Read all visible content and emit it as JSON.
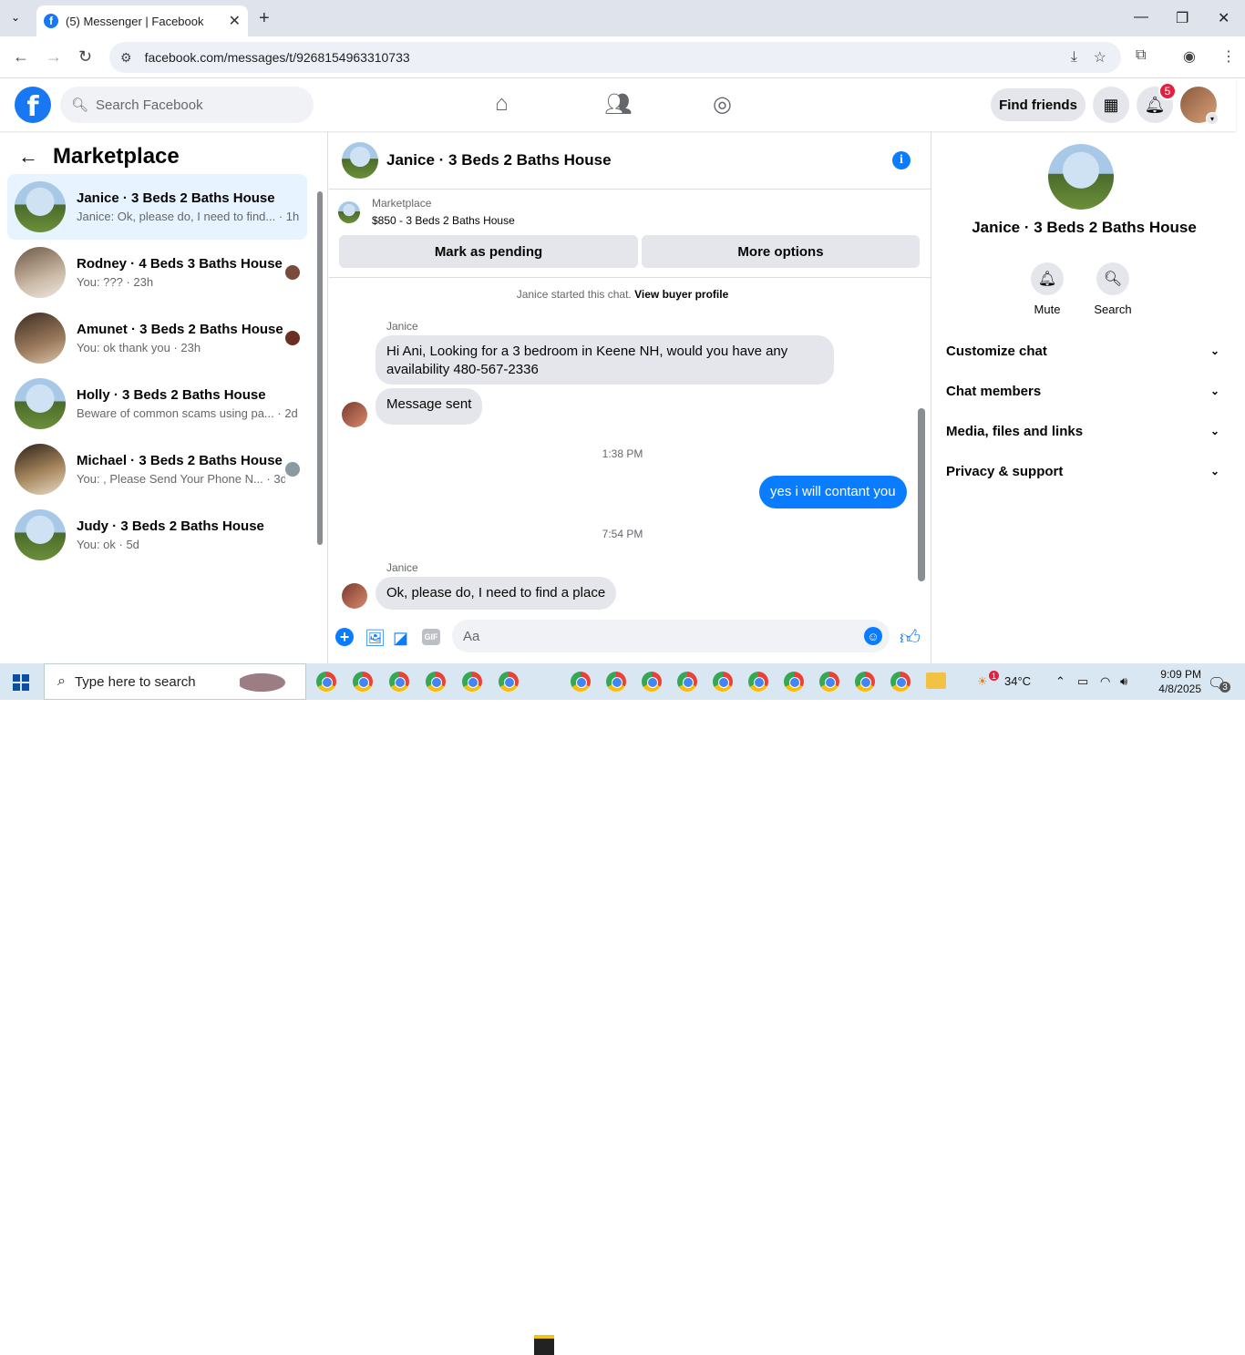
{
  "browser": {
    "tab_title": "(5) Messenger | Facebook",
    "url": "facebook.com/messages/t/9268154963310733"
  },
  "fb_header": {
    "search_placeholder": "Search Facebook",
    "find_friends": "Find friends",
    "notification_count": "5"
  },
  "left": {
    "title": "Marketplace",
    "conversations": [
      {
        "name": "Janice · 3 Beds 2 Baths House",
        "preview": "Janice: Ok, please do, I need to find... · 1h"
      },
      {
        "name": "Rodney · 4 Beds 3 Baths House",
        "preview": "You: ??? · 23h"
      },
      {
        "name": "Amunet · 3 Beds 2 Baths House",
        "preview": "You: ok thank you · 23h"
      },
      {
        "name": "Holly · 3 Beds 2 Baths House",
        "preview": "Beware of common scams using pa... · 2d"
      },
      {
        "name": "Michael · 3 Beds 2 Baths House",
        "preview": "You: , Please Send Your Phone N... · 3d"
      },
      {
        "name": "Judy · 3 Beds 2 Baths House",
        "preview": "You: ok · 5d"
      }
    ]
  },
  "chat": {
    "title": "Janice · 3 Beds 2 Baths House",
    "listing_label": "Marketplace",
    "listing_price": "$850 - 3 Beds 2 Baths House",
    "btn_pending": "Mark as pending",
    "btn_more": "More options",
    "system_msg": "Janice started this chat.",
    "view_profile": "View buyer profile",
    "sender1": "Janice",
    "msg1": "Hi Ani,  Looking for a 3 bedroom in Keene NH, would you have any availability 480-567-2336",
    "msg2": "Message sent",
    "time1": "1:38 PM",
    "msg3": "yes i will contant you",
    "time2": "7:54 PM",
    "sender2": "Janice",
    "msg4": "Ok, please do, I need to find a place",
    "composer_placeholder": "Aa"
  },
  "right": {
    "name": "Janice · 3 Beds 2 Baths House",
    "mute": "Mute",
    "search": "Search",
    "sections": [
      "Customize chat",
      "Chat members",
      "Media, files and links",
      "Privacy & support"
    ]
  },
  "taskbar": {
    "search_placeholder": "Type here to search",
    "temperature": "34°C",
    "time": "9:09 PM",
    "date": "4/8/2025",
    "weather_badge": "1",
    "notif_count": "3"
  }
}
